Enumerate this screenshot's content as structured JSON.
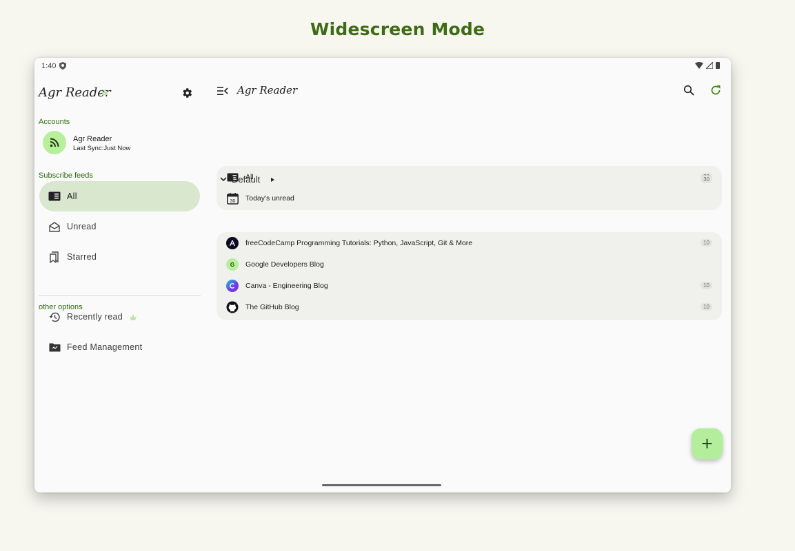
{
  "page": {
    "heading": "Widescreen Mode"
  },
  "statusbar": {
    "time": "1:40"
  },
  "sidebar": {
    "app_title": "Agr Reader",
    "accounts_label": "Accounts",
    "account": {
      "name": "Agr Reader",
      "last_sync": "Last Sync:Just Now"
    },
    "subscribe_label": "Subscribe feeds",
    "items": [
      {
        "label": "All",
        "icon": "feed-icon",
        "active": true
      },
      {
        "label": "Unread",
        "icon": "open-mail-icon"
      },
      {
        "label": "Starred",
        "icon": "bookmark-icon"
      }
    ],
    "other_label": "other options",
    "other_items": [
      {
        "label": "Recently read",
        "icon": "history-icon"
      },
      {
        "label": "Feed Management",
        "icon": "folder-icon"
      }
    ]
  },
  "main": {
    "title": "Agr Reader",
    "top_rows": [
      {
        "label": "All",
        "count": "30",
        "icon": "feed-icon"
      },
      {
        "label": "Today's unread",
        "count": "",
        "icon": "calendar-icon",
        "calendar_day": "30"
      }
    ],
    "group": {
      "label": "Default",
      "count": "30"
    },
    "feeds": [
      {
        "label": "freeCodeCamp Programming Tutorials: Python, JavaScript, Git & More",
        "count": "10",
        "icon": "freecodecamp-icon"
      },
      {
        "label": "Google Developers Blog",
        "count": "",
        "icon": "letter-g-icon",
        "initial": "G"
      },
      {
        "label": "Canva - Engineering Blog",
        "count": "10",
        "icon": "canva-icon"
      },
      {
        "label": "The GitHub Blog",
        "count": "10",
        "icon": "github-icon"
      }
    ],
    "fab": "+"
  },
  "colors": {
    "accent": "#3e6b16",
    "active_bg": "#d9e7cf",
    "fab": "#b3ee9c",
    "card": "#f0f1ec"
  }
}
